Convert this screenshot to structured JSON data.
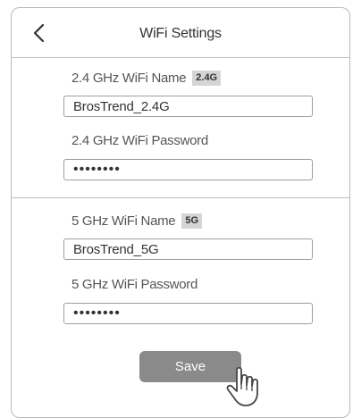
{
  "header": {
    "title": "WiFi Settings",
    "back_icon": "chevron-left-icon"
  },
  "band_24": {
    "name_label": "2.4 GHz WiFi Name",
    "badge": "2.4G",
    "name_value": "BrosTrend_2.4G",
    "password_label": "2.4 GHz WiFi Password",
    "password_value": "••••••••"
  },
  "band_5": {
    "name_label": "5 GHz WiFi Name",
    "badge": "5G",
    "name_value": "BrosTrend_5G",
    "password_label": "5 GHz WiFi Password",
    "password_value": "••••••••"
  },
  "actions": {
    "save_label": "Save",
    "pointer_icon": "hand-pointer-icon"
  },
  "colors": {
    "button": "#8a8a8a",
    "border": "#bdbdbd",
    "badge": "#d5d5d5"
  }
}
